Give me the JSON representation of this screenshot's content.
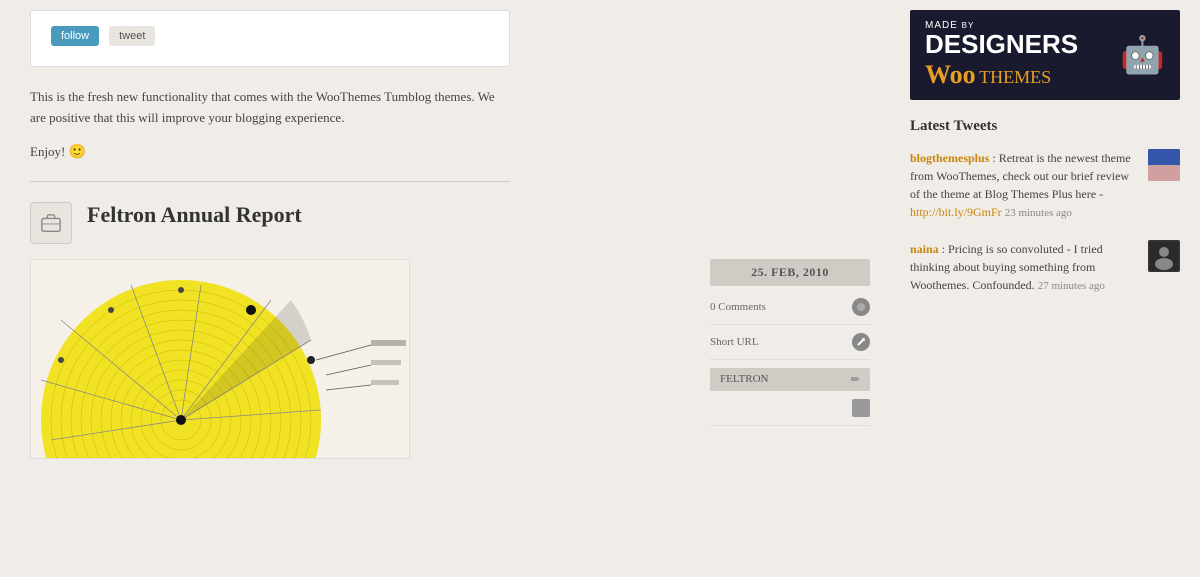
{
  "main": {
    "top_post": {
      "button_follow": "follow",
      "button_tweet": "tweet"
    },
    "intro_text_1": "This is the fresh new functionality that comes with the WooThemes Tumblog themes. We are positive that this will improve your blogging experience.",
    "intro_text_2": "Enjoy!",
    "featured_post": {
      "title": "Feltron Annual Report",
      "date": "25. FEB, 2010",
      "comments": "0 Comments",
      "short_url": "Short URL",
      "tag": "FELTRON",
      "icon_alt": "briefcase"
    }
  },
  "sidebar": {
    "ad": {
      "made_by": "MADE",
      "by": "BY",
      "designers": "DESIGNERS",
      "woo": "Woo",
      "themes": "THEMES"
    },
    "latest_tweets_title": "Latest Tweets",
    "tweets": [
      {
        "username": "blogthemesplus",
        "text": "Retreat is the newest theme from WooThemes, check out our brief review of the theme at Blog Themes Plus here - ",
        "link": "http://bit.ly/9GmFr",
        "time": "23 minutes ago"
      },
      {
        "username": "naina",
        "text": "Pricing is so convoluted - I tried thinking about buying something from Woothemes. Confounded.",
        "time": "27 minutes ago"
      }
    ]
  }
}
